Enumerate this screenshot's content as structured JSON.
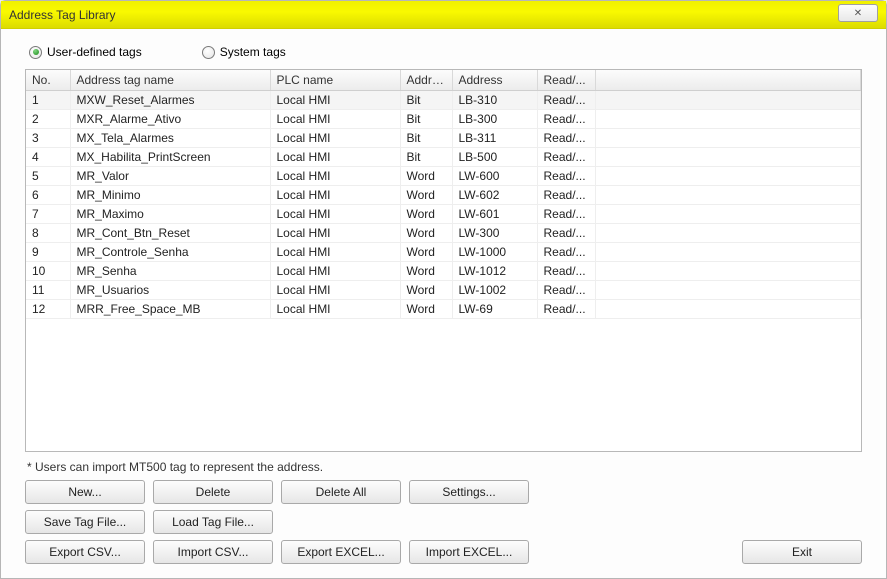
{
  "window": {
    "title": "Address Tag Library",
    "close_glyph": "✕"
  },
  "tabs": {
    "user_defined": {
      "label": "User-defined tags",
      "checked": true
    },
    "system": {
      "label": "System tags",
      "checked": false
    }
  },
  "columns": {
    "no": "No.",
    "name": "Address tag name",
    "plc": "PLC name",
    "atype": "Addre...",
    "addr": "Address",
    "rw": "Read/..."
  },
  "rows": [
    {
      "no": "1",
      "name": "MXW_Reset_Alarmes",
      "plc": "Local HMI",
      "atype": "Bit",
      "addr": "LB-310",
      "rw": "Read/..."
    },
    {
      "no": "2",
      "name": "MXR_Alarme_Ativo",
      "plc": "Local HMI",
      "atype": "Bit",
      "addr": "LB-300",
      "rw": "Read/..."
    },
    {
      "no": "3",
      "name": "MX_Tela_Alarmes",
      "plc": "Local HMI",
      "atype": "Bit",
      "addr": "LB-311",
      "rw": "Read/..."
    },
    {
      "no": "4",
      "name": "MX_Habilita_PrintScreen",
      "plc": "Local HMI",
      "atype": "Bit",
      "addr": "LB-500",
      "rw": "Read/..."
    },
    {
      "no": "5",
      "name": "MR_Valor",
      "plc": "Local HMI",
      "atype": "Word",
      "addr": "LW-600",
      "rw": "Read/..."
    },
    {
      "no": "6",
      "name": "MR_Minimo",
      "plc": "Local HMI",
      "atype": "Word",
      "addr": "LW-602",
      "rw": "Read/..."
    },
    {
      "no": "7",
      "name": "MR_Maximo",
      "plc": "Local HMI",
      "atype": "Word",
      "addr": "LW-601",
      "rw": "Read/..."
    },
    {
      "no": "8",
      "name": "MR_Cont_Btn_Reset",
      "plc": "Local HMI",
      "atype": "Word",
      "addr": "LW-300",
      "rw": "Read/..."
    },
    {
      "no": "9",
      "name": "MR_Controle_Senha",
      "plc": "Local HMI",
      "atype": "Word",
      "addr": "LW-1000",
      "rw": "Read/..."
    },
    {
      "no": "10",
      "name": "MR_Senha",
      "plc": "Local HMI",
      "atype": "Word",
      "addr": "LW-1012",
      "rw": "Read/..."
    },
    {
      "no": "11",
      "name": "MR_Usuarios",
      "plc": "Local HMI",
      "atype": "Word",
      "addr": "LW-1002",
      "rw": "Read/..."
    },
    {
      "no": "12",
      "name": "MRR_Free_Space_MB",
      "plc": "Local HMI",
      "atype": "Word",
      "addr": "LW-69",
      "rw": "Read/..."
    }
  ],
  "hint": "* Users can import MT500 tag to represent the address.",
  "buttons": {
    "new": "New...",
    "delete": "Delete",
    "delete_all": "Delete All",
    "settings": "Settings...",
    "save_tag_file": "Save Tag File...",
    "load_tag_file": "Load Tag File...",
    "export_csv": "Export CSV...",
    "import_csv": "Import CSV...",
    "export_excel": "Export EXCEL...",
    "import_excel": "Import EXCEL...",
    "exit": "Exit"
  }
}
